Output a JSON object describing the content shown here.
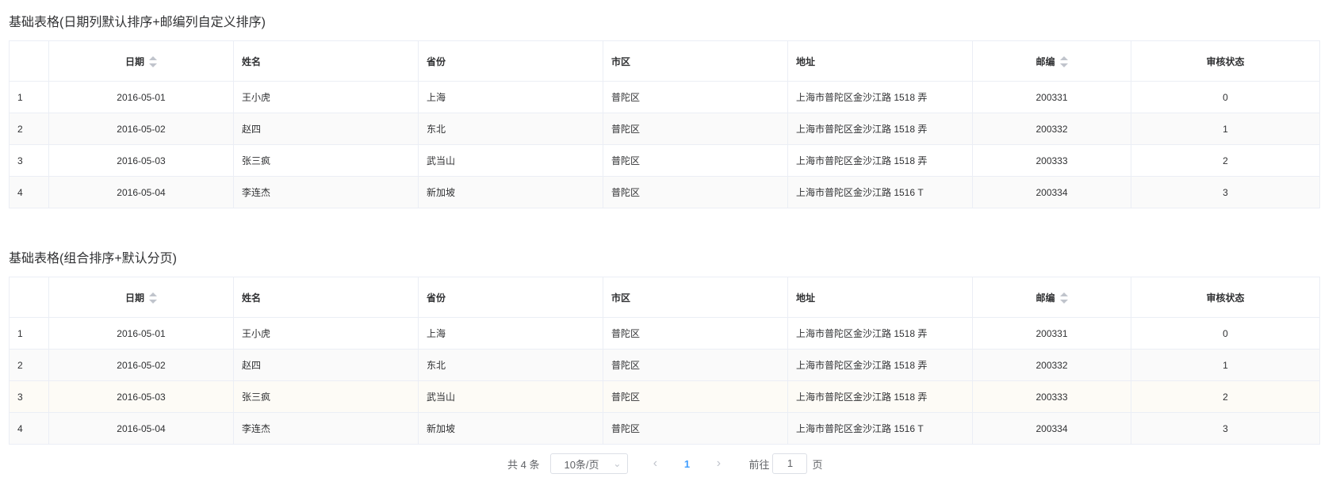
{
  "table1": {
    "title": "基础表格(日期列默认排序+邮编列自定义排序)",
    "headers": [
      "",
      "日期",
      "姓名",
      "省份",
      "市区",
      "地址",
      "邮编",
      "审核状态"
    ],
    "rows": [
      [
        "1",
        "2016-05-01",
        "王小虎",
        "上海",
        "普陀区",
        "上海市普陀区金沙江路 1518 弄",
        "200331",
        "0"
      ],
      [
        "2",
        "2016-05-02",
        "赵四",
        "东北",
        "普陀区",
        "上海市普陀区金沙江路 1518 弄",
        "200332",
        "1"
      ],
      [
        "3",
        "2016-05-03",
        "张三疯",
        "武当山",
        "普陀区",
        "上海市普陀区金沙江路 1518 弄",
        "200333",
        "2"
      ],
      [
        "4",
        "2016-05-04",
        "李连杰",
        "新加坡",
        "普陀区",
        "上海市普陀区金沙江路 1516 T",
        "200334",
        "3"
      ]
    ]
  },
  "table2": {
    "title": "基础表格(组合排序+默认分页)",
    "headers": [
      "",
      "日期",
      "姓名",
      "省份",
      "市区",
      "地址",
      "邮编",
      "审核状态"
    ],
    "rows": [
      [
        "1",
        "2016-05-01",
        "王小虎",
        "上海",
        "普陀区",
        "上海市普陀区金沙江路 1518 弄",
        "200331",
        "0"
      ],
      [
        "2",
        "2016-05-02",
        "赵四",
        "东北",
        "普陀区",
        "上海市普陀区金沙江路 1518 弄",
        "200332",
        "1"
      ],
      [
        "3",
        "2016-05-03",
        "张三疯",
        "武当山",
        "普陀区",
        "上海市普陀区金沙江路 1518 弄",
        "200333",
        "2"
      ],
      [
        "4",
        "2016-05-04",
        "李连杰",
        "新加坡",
        "普陀区",
        "上海市普陀区金沙江路 1516 T",
        "200334",
        "3"
      ]
    ]
  },
  "pagination": {
    "total": "共 4 条",
    "page_size": "10条/页",
    "current_page": "1",
    "goto_prefix": "前往",
    "goto_value": "1",
    "goto_suffix": "页"
  },
  "colors": {
    "accent": "#409eff",
    "border": "#ebeef5",
    "stripe": "#fafafa",
    "hover_row": "#fdfbf6"
  }
}
